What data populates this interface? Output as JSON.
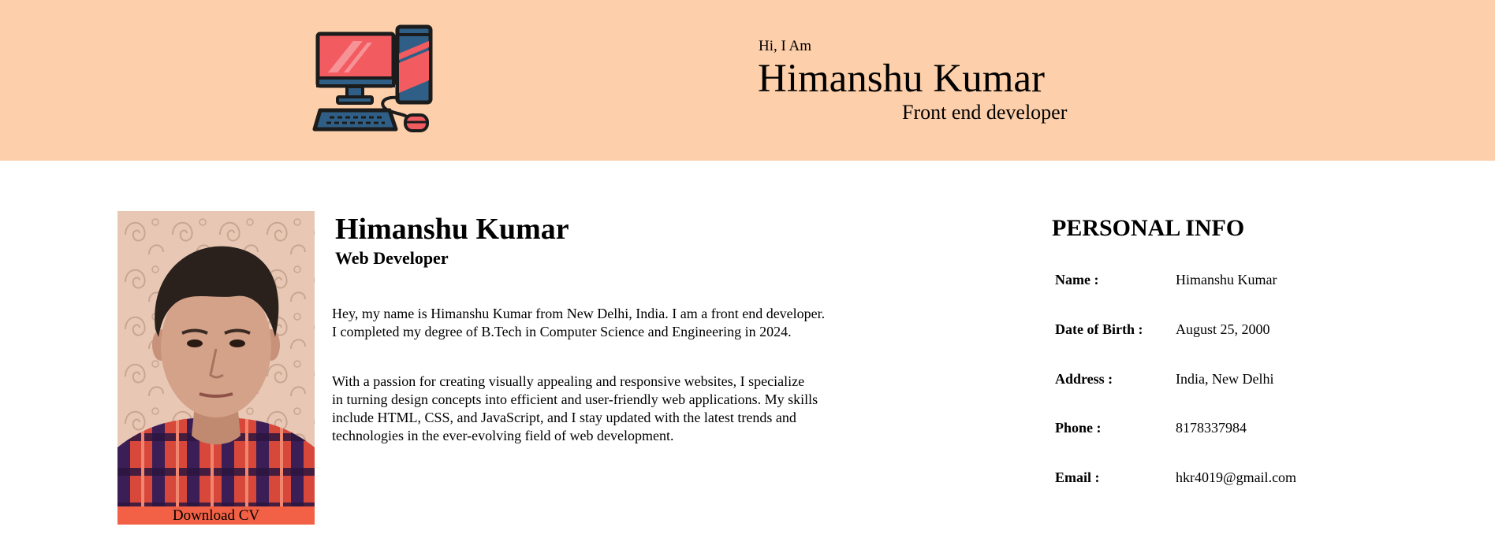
{
  "header": {
    "logo_icon": "desktop-computer-icon",
    "greeting": "Hi, I Am",
    "name": "Himanshu Kumar",
    "role": "Front end developer",
    "background_color": "#fdcfaa"
  },
  "profile": {
    "photo": "profile-photo",
    "download_label": "Download CV",
    "download_color": "#f26145"
  },
  "about": {
    "name": "Himanshu Kumar",
    "role": "Web Developer",
    "paragraph1_lines": [
      "Hey, my name is Himanshu Kumar from New Delhi, India. I am a front end developer.",
      "I completed my degree of B.Tech in Computer Science and Engineering in 2024."
    ],
    "paragraph2_lines": [
      "With a passion for creating visually appealing and responsive websites, I specialize",
      "in turning design concepts into efficient and user-friendly web applications. My skills",
      "include HTML, CSS, and JavaScript, and I stay updated with the latest trends and",
      "technologies in the ever-evolving field of web development."
    ]
  },
  "personal_info": {
    "title": "PERSONAL INFO",
    "rows": [
      {
        "label": "Name :",
        "value": "Himanshu Kumar"
      },
      {
        "label": "Date of Birth :",
        "value": "August 25, 2000"
      },
      {
        "label": "Address :",
        "value": "India, New Delhi"
      },
      {
        "label": "Phone :",
        "value": "8178337984"
      },
      {
        "label": "Email :",
        "value": "hkr4019@gmail.com"
      }
    ]
  }
}
